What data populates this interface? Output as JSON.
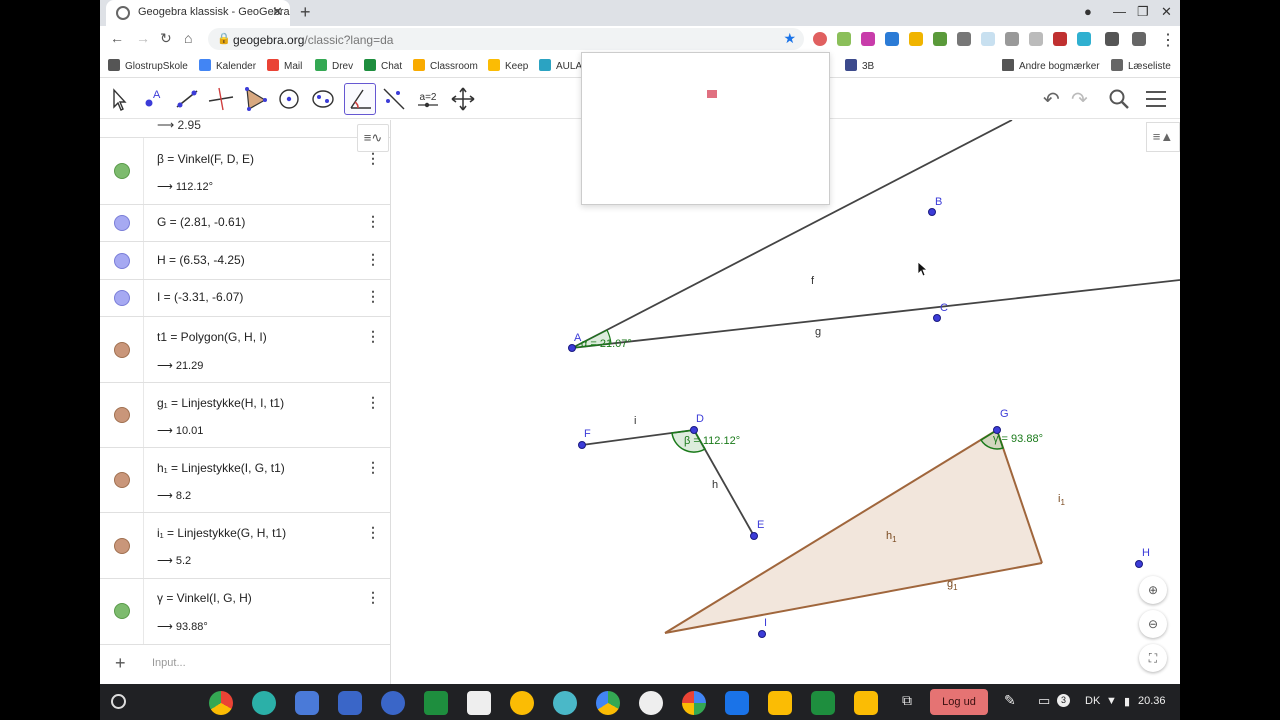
{
  "browser": {
    "tab_title": "Geogebra klassisk - GeoGebra",
    "url_host": "geogebra.org",
    "url_path": "/classic?lang=da"
  },
  "bookmarks": {
    "items": [
      "GlostrupSkole",
      "Kalender",
      "Mail",
      "Drev",
      "Chat",
      "Classroom",
      "Keep",
      "AULA",
      "3B"
    ],
    "other": "Andre bogmærker",
    "reading_list": "Læseliste"
  },
  "toolbar": {
    "slider_label": "a=2"
  },
  "algebra": {
    "top_value": "⟶  2.95",
    "rows": [
      {
        "def": "β = Vinkel(F, D, E)",
        "val": "⟶  112.12°",
        "color": "#7dbb6e"
      },
      {
        "def": "G = (2.81, -0.61)",
        "val": "",
        "color": "#a6a9f2"
      },
      {
        "def": "H = (6.53, -4.25)",
        "val": "",
        "color": "#a6a9f2"
      },
      {
        "def": "I = (-3.31, -6.07)",
        "val": "",
        "color": "#a6a9f2"
      },
      {
        "def": "t1 = Polygon(G, H, I)",
        "val": "⟶  21.29",
        "color": "#c9967a"
      },
      {
        "def": "g₁ = Linjestykke(H, I, t1)",
        "val": "⟶  10.01",
        "color": "#c9967a"
      },
      {
        "def": "h₁ = Linjestykke(I, G, t1)",
        "val": "⟶  8.2",
        "color": "#c9967a"
      },
      {
        "def": "i₁ = Linjestykke(G, H, t1)",
        "val": "⟶  5.2",
        "color": "#c9967a"
      },
      {
        "def": "γ = Vinkel(I, G, H)",
        "val": "⟶  93.88°",
        "color": "#7dbb6e"
      }
    ],
    "input_placeholder": "Input..."
  },
  "graphics": {
    "points": {
      "A": "A",
      "B": "B",
      "C": "C",
      "D": "D",
      "E": "E",
      "F": "F",
      "G": "G",
      "H": "H",
      "I": "I"
    },
    "segment_labels": {
      "f": "f",
      "g": "g",
      "h": "h",
      "i": "i",
      "h1": "h",
      "g1": "g",
      "i1": "i",
      "sub": "1"
    },
    "angle_labels": {
      "alpha": "α = 21.07°",
      "beta": "β = 112.12°",
      "gamma": "γ = 93.88°"
    },
    "colors": {
      "point": "#3c3cd8",
      "segment": "#444444",
      "polygon": "#a0663c",
      "angle": "#1a7a1a"
    }
  },
  "shelf": {
    "logout": "Log ud",
    "badge": "3",
    "locale": "DK",
    "time": "20.36"
  }
}
